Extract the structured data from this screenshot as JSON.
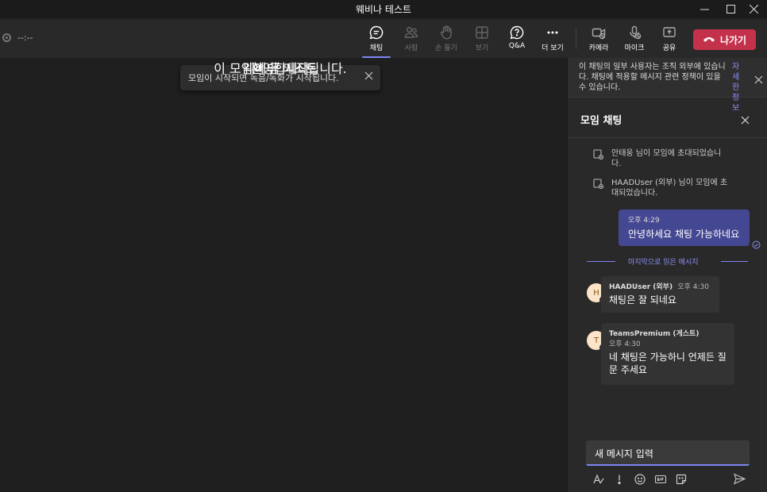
{
  "window": {
    "title": "웨비나 테스트",
    "controls": [
      "minimize-icon",
      "maximize-icon",
      "close-icon"
    ]
  },
  "toolbar": {
    "timer": "--:--",
    "buttons": [
      {
        "label": "채팅",
        "icon": "chat-icon",
        "active": true
      },
      {
        "label": "사람",
        "icon": "people-icon",
        "enabled": false
      },
      {
        "label": "손 들기",
        "icon": "raise-hand-icon",
        "enabled": false
      },
      {
        "label": "보기",
        "icon": "view-icon",
        "enabled": false
      },
      {
        "label": "Q&A",
        "icon": "qna-icon"
      },
      {
        "label": "더 보기",
        "icon": "more-icon"
      },
      {
        "label": "카메라",
        "icon": "camera-off-icon"
      },
      {
        "label": "마이크",
        "icon": "mic-off-icon"
      },
      {
        "label": "공유",
        "icon": "share-icon"
      }
    ],
    "leave_label": "나가기"
  },
  "stage": {
    "toast": "모임이 시작되면 녹음/녹화가 시작됩니다.",
    "welcome": "환영합니다",
    "title": "웨비나 테스트",
    "subtitle": "이 모임이 곧 시작됩니다."
  },
  "chat": {
    "banner_text": "이 채팅의 일부 사용자는 조직 외부에 있습니다. 채팅에 적용할 메시지 관련 정책이 있을 수 있습니다.",
    "banner_link": "자세한 정보",
    "title": "모임 채팅",
    "system_messages": [
      "안태웅 님이 모임에 초대되었습니다.",
      "HAADUser (외부) 님이 모임에 초대되었습니다."
    ],
    "my_message": {
      "time": "오후 4:29",
      "text": "안녕하세요 채팅 가능하네요"
    },
    "last_read_label": "마지막으로 읽은 메시지",
    "messages": [
      {
        "initial": "H",
        "sender": "HAADUser (외부)",
        "time": "오후 4:30",
        "text": "채팅은 잘 되네요"
      },
      {
        "initial": "T",
        "sender": "TeamsPremium (게스트)",
        "time": "오후 4:30",
        "text": "네 채팅은 가능하니 언제든 질문 주세요"
      }
    ],
    "compose_placeholder": "새 메시지 입력",
    "compose_tools": [
      "format-icon",
      "priority-icon",
      "emoji-icon",
      "gif-icon",
      "sticker-icon"
    ],
    "send_icon": "send-icon"
  },
  "colors": {
    "accent": "#7f85f5",
    "my_bubble": "#444791",
    "leave": "#c4314b"
  }
}
